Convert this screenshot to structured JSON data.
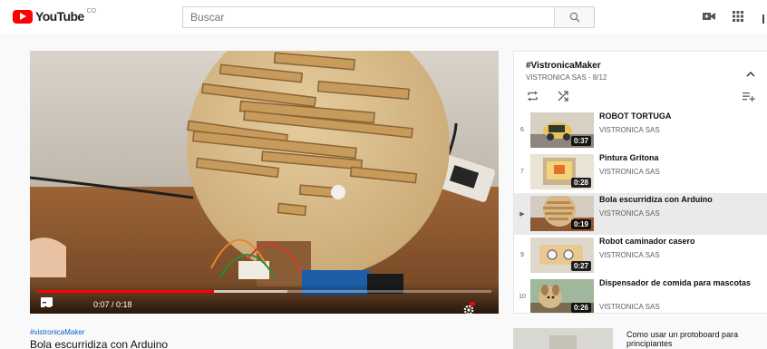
{
  "header": {
    "logo_text": "YouTube",
    "logo_cc": "CO",
    "search_placeholder": "Buscar",
    "icons": [
      "create-video-icon",
      "apps-grid-icon"
    ]
  },
  "player": {
    "time_current": "0:07",
    "time_separator": " / ",
    "time_total": "0:18",
    "progress_fraction": 0.39,
    "buffered_fraction": 0.55,
    "icons": [
      "skip-back-icon",
      "play-icon",
      "skip-next-icon",
      "volume-icon",
      "subtitles-icon",
      "settings-hd-icon",
      "miniplayer-icon",
      "theater-icon",
      "fullscreen-icon"
    ]
  },
  "video": {
    "hashtag": "#vistronicaMaker",
    "title": "Bola escurridiza con Arduino"
  },
  "playlist": {
    "title": "#VistronicaMaker",
    "subtitle": "VISTRONICA SAS - 8/12",
    "items": [
      {
        "index": "6",
        "title": "ROBOT TORTUGA",
        "channel": "VISTRONICA SAS",
        "duration": "0:37",
        "active": false
      },
      {
        "index": "7",
        "title": "Pintura Gritona",
        "channel": "VISTRONICA SAS",
        "duration": "0:28",
        "active": false
      },
      {
        "index": "▶",
        "title": "Bola escurridiza con Arduino",
        "channel": "VISTRONICA SAS",
        "duration": "0:19",
        "active": true
      },
      {
        "index": "9",
        "title": "Robot caminador casero",
        "channel": "VISTRONICA SAS",
        "duration": "0:27",
        "active": false
      },
      {
        "index": "10",
        "title": "Dispensador de comida para mascotas",
        "channel": "VISTRONICA SAS",
        "duration": "0:26",
        "active": false
      }
    ]
  },
  "recommendation": {
    "title": "Como usar un protoboard para principiantes"
  },
  "colors": {
    "brand_red": "#ff0000",
    "link_blue": "#065fd4",
    "secondary_text": "#606060"
  }
}
